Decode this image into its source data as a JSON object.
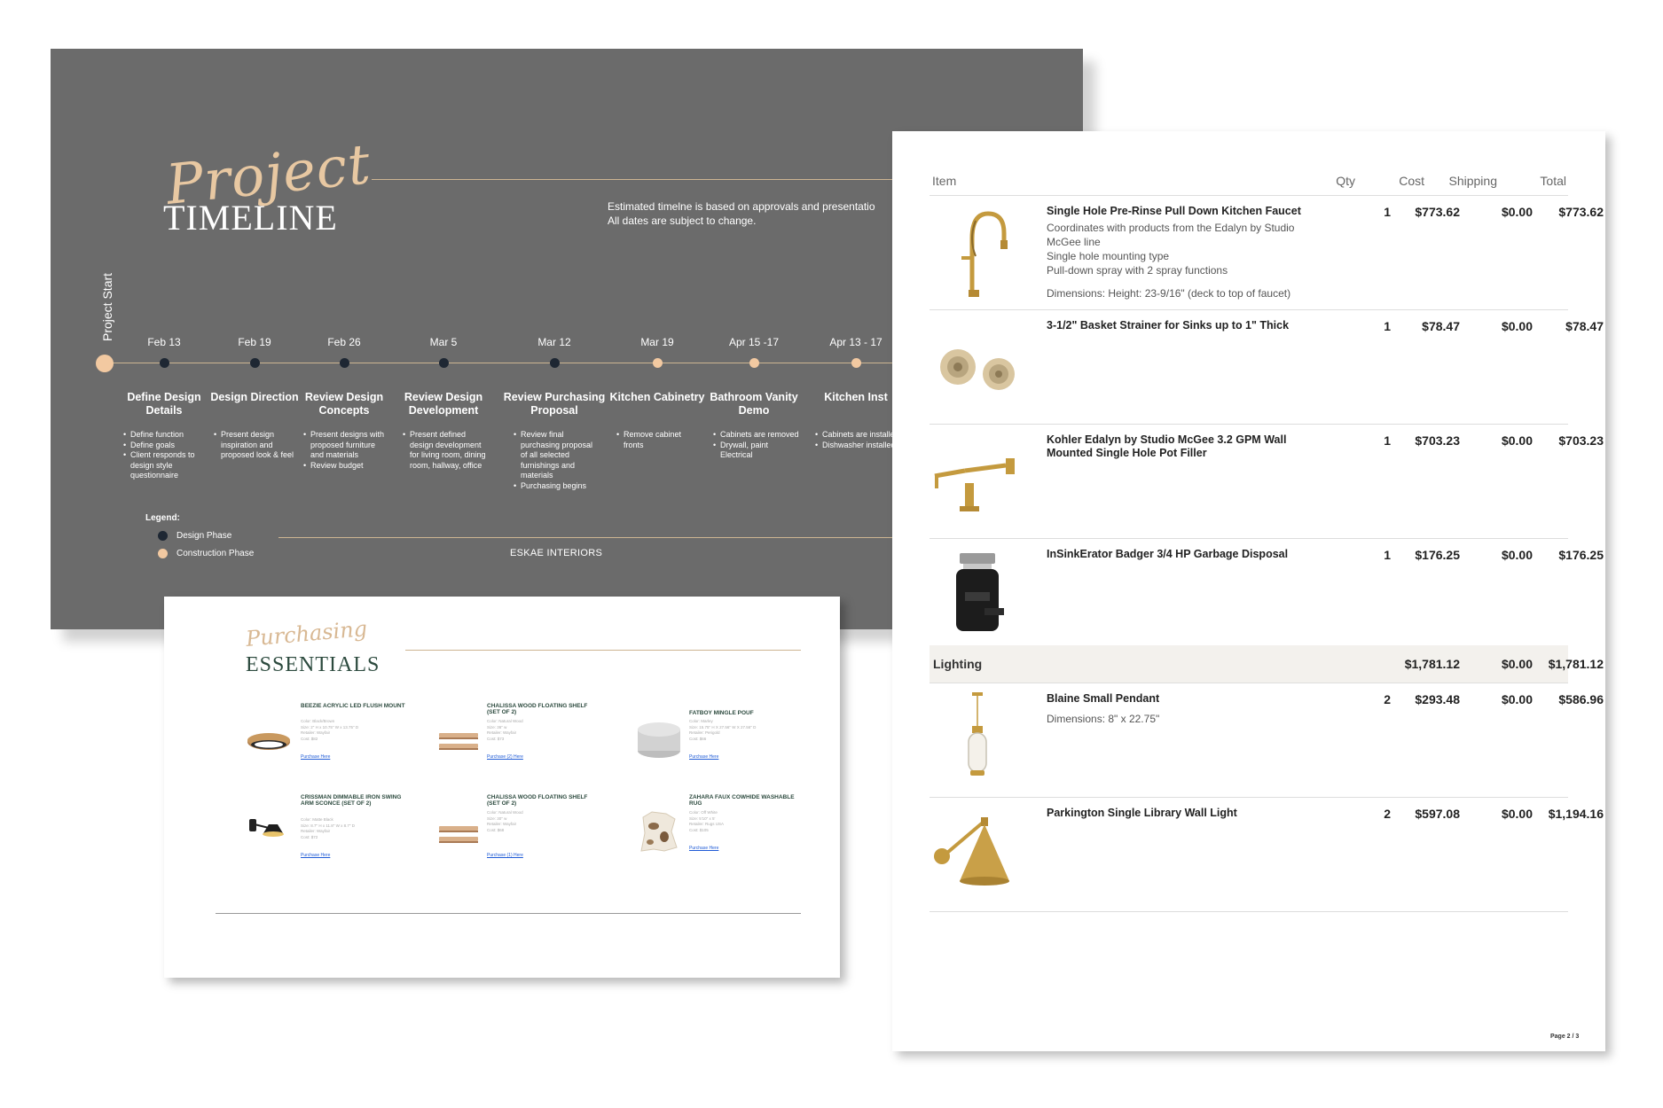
{
  "timeline": {
    "title_script": "Project",
    "title_caps": "TIMELINE",
    "note": "Estimated timelne is based on approvals and presentatio\nAll dates are subject to change.",
    "start_label": "Project Start",
    "milestones": [
      {
        "date": "Feb 13",
        "title": "Define Design Details",
        "phase": "design",
        "bullets": [
          "Define function",
          "Define goals",
          "Client responds to design style questionnaire"
        ]
      },
      {
        "date": "Feb 19",
        "title": "Design Direction",
        "phase": "design",
        "bullets": [
          "Present design inspiration and proposed look & feel"
        ]
      },
      {
        "date": "Feb 26",
        "title": "Review Design Concepts",
        "phase": "design",
        "bullets": [
          "Present designs with proposed furniture and materials",
          "Review budget"
        ]
      },
      {
        "date": "Mar 5",
        "title": "Review Design Development",
        "phase": "design",
        "bullets": [
          "Present defined design development for living room, dining room, hallway, office"
        ]
      },
      {
        "date": "Mar 12",
        "title": "Review Purchasing Proposal",
        "phase": "design",
        "bullets": [
          "Review final purchasing proposal of all selected furnishings and materials",
          "Purchasing begins"
        ]
      },
      {
        "date": "Mar 19",
        "title": "Kitchen Cabinetry",
        "phase": "construction",
        "bullets": [
          "Remove cabinet fronts"
        ]
      },
      {
        "date": "Apr 15 -17",
        "title": "Bathroom Vanity Demo",
        "phase": "construction",
        "bullets": [
          "Cabinets are removed",
          "Drywall, paint Electrical"
        ]
      },
      {
        "date": "Apr 13 - 17",
        "title": "Kitchen Inst",
        "phase": "construction",
        "bullets": [
          "Cabinets are installed",
          "Dishwasher installed"
        ]
      }
    ],
    "legend_title": "Legend:",
    "legend": [
      {
        "label": "Design Phase",
        "color": "#1e2733"
      },
      {
        "label": "Construction Phase",
        "color": "#f2c9a1"
      }
    ],
    "footer": "ESKAE INTERIORS"
  },
  "purchasing": {
    "title_script": "Purchasing",
    "title_caps": "ESSENTIALS",
    "items": [
      {
        "name": "BEEZIE ACRYLIC LED FLUSH MOUNT",
        "icon": "flush-mount-light",
        "specs": "Color: Black/Brown\nSize: 2\" H x 10.75\" W x 13.75\" D\nRetailer: Wayfair\nCost: $82",
        "link": "Purchase Here"
      },
      {
        "name": "CHALISSA WOOD FLOATING SHELF (SET OF 2)",
        "icon": "floating-shelf",
        "specs": "Color: Natural Wood\nSize: 36\" w\nRetailer: Wayfair\nCost: $73",
        "link": "Purchase (2) Here"
      },
      {
        "name": "FATBOY MINGLE POUF",
        "icon": "pouf",
        "specs": "Color: Marley\nSize: 15.75\" H X 27.56\" W X 27.56\" D\nRetailer: Perigold\nCost: $66",
        "link": "Purchase Here"
      },
      {
        "name": "CRISSMAN DIMMABLE IRON SWING ARM SCONCE (SET OF 2)",
        "icon": "swing-arm-sconce",
        "specs": "Color: Matte Black\nSize: 8.7\" H x 11.8\" W x 8.7\" D\nRetailer: Wayfair\nCost: $72",
        "link": "Purchase Here"
      },
      {
        "name": "CHALISSA WOOD FLOATING SHELF (SET OF 2)",
        "icon": "floating-shelf",
        "specs": "Color: Natural Wood\nSize: 30\" w\nRetailer: Wayfair\nCost: $68",
        "link": "Purchase (1) Here"
      },
      {
        "name": "ZAHARA FAUX COWHIDE WASHABLE RUG",
        "icon": "cowhide-rug",
        "specs": "Color: Off White\nSize: 5'10\" x 5'\nRetailer: Rugs USA\nCost: $105",
        "link": "Purchase Here"
      }
    ]
  },
  "invoice": {
    "headers": {
      "item": "Item",
      "qty": "Qty",
      "cost": "Cost",
      "shipping": "Shipping",
      "total": "Total"
    },
    "rows": [
      {
        "name": "Single Hole Pre-Rinse Pull Down Kitchen Faucet",
        "description": "Coordinates with products from the Edalyn by Studio McGee line\nSingle hole mounting type\nPull-down spray with 2 spray functions",
        "dimensions": "Dimensions: Height: 23-9/16\" (deck to top of faucet)",
        "icon": "kitchen-faucet",
        "qty": "1",
        "cost": "$773.62",
        "shipping": "$0.00",
        "total": "$773.62"
      },
      {
        "name": "3-1/2\" Basket Strainer for Sinks up to 1\" Thick",
        "description": "",
        "dimensions": "",
        "icon": "basket-strainer",
        "qty": "1",
        "cost": "$78.47",
        "shipping": "$0.00",
        "total": "$78.47"
      },
      {
        "name": "Kohler Edalyn by Studio McGee 3.2 GPM Wall Mounted Single Hole Pot Filler",
        "description": "",
        "dimensions": "",
        "icon": "pot-filler",
        "qty": "1",
        "cost": "$703.23",
        "shipping": "$0.00",
        "total": "$703.23"
      },
      {
        "name": "InSinkErator Badger 3/4 HP Garbage Disposal",
        "description": "",
        "dimensions": "",
        "icon": "garbage-disposal",
        "qty": "1",
        "cost": "$176.25",
        "shipping": "$0.00",
        "total": "$176.25"
      }
    ],
    "section": {
      "label": "Lighting",
      "cost": "$1,781.12",
      "shipping": "$0.00",
      "total": "$1,781.12"
    },
    "lighting_rows": [
      {
        "name": "Blaine Small Pendant",
        "description": "",
        "dimensions": "Dimensions: 8\" x 22.75\"",
        "icon": "pendant-light",
        "qty": "2",
        "cost": "$293.48",
        "shipping": "$0.00",
        "total": "$586.96"
      },
      {
        "name": "Parkington Single Library Wall Light",
        "description": "",
        "dimensions": "",
        "icon": "library-wall-light",
        "qty": "2",
        "cost": "$597.08",
        "shipping": "$0.00",
        "total": "$1,194.16"
      }
    ],
    "page": "Page 2 / 3"
  }
}
